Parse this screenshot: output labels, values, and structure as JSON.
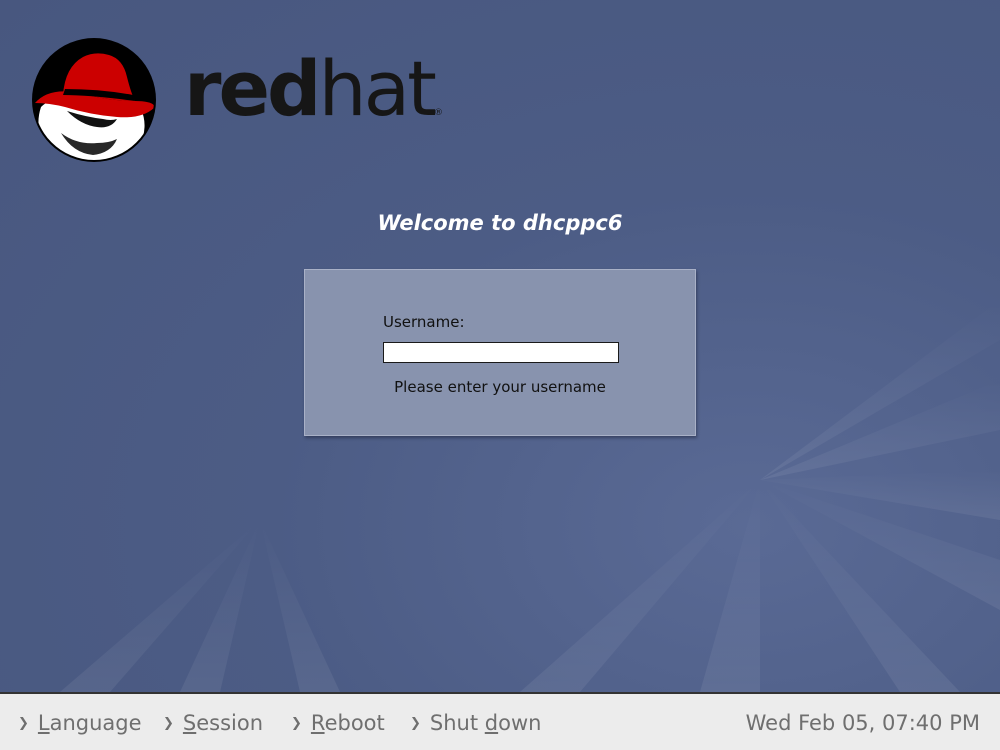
{
  "branding": {
    "logo_icon": "redhat-shadowman-icon",
    "name_bold": "red",
    "name_light": "hat",
    "registered": "®"
  },
  "welcome": {
    "prefix": "Welcome to ",
    "hostname": "dhcppc6"
  },
  "login": {
    "username_label": "Username:",
    "username_value": "",
    "hint": "Please enter your username"
  },
  "bottom_bar": {
    "items": [
      {
        "accel": "L",
        "rest": "anguage",
        "icon": "chevron-right-icon"
      },
      {
        "accel": "S",
        "rest": "ession",
        "icon": "chevron-right-icon"
      },
      {
        "accel": "R",
        "rest": "eboot",
        "icon": "chevron-right-icon"
      },
      {
        "before": "Shut ",
        "accel": "d",
        "rest": "own",
        "icon": "chevron-right-icon"
      }
    ],
    "clock": "Wed Feb 05, 07:40 PM"
  },
  "colors": {
    "background": "#4c5c85",
    "login_box": "#8893ae",
    "bottom_bar": "#ececec",
    "hat_red": "#cc0000",
    "menu_text": "#6f6f6f"
  }
}
